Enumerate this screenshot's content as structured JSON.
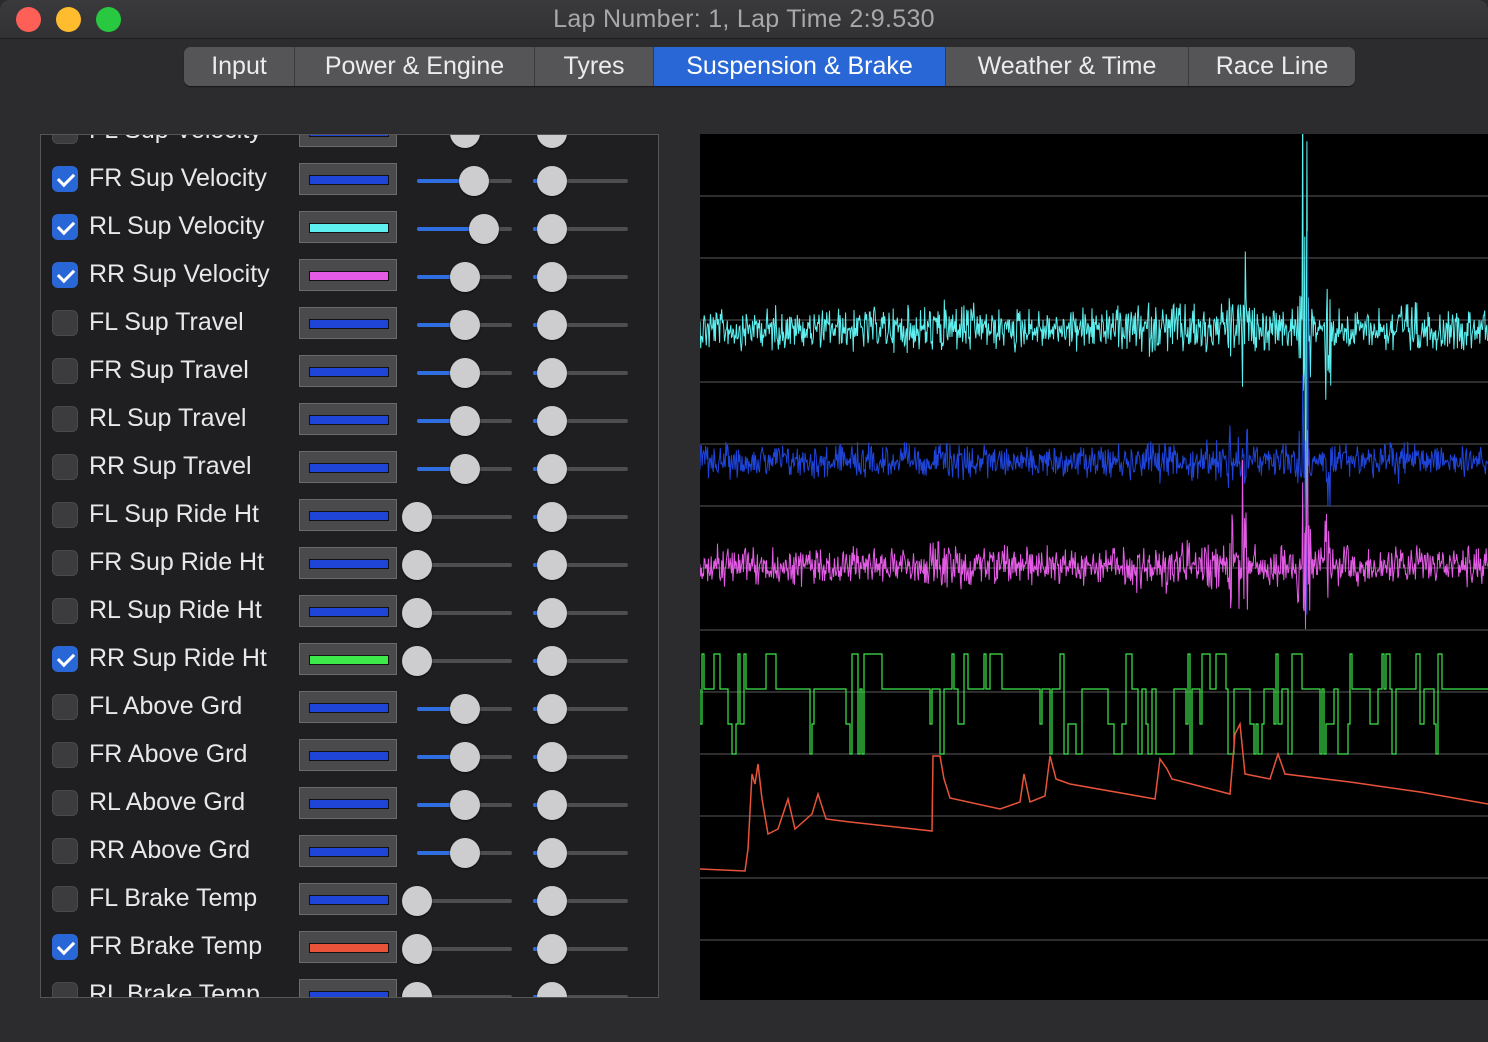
{
  "window": {
    "title": "Lap Number: 1, Lap Time 2:9.530"
  },
  "tabs": [
    {
      "label": "Input",
      "active": false
    },
    {
      "label": "Power & Engine",
      "active": false
    },
    {
      "label": "Tyres",
      "active": false
    },
    {
      "label": "Suspension & Brake",
      "active": true
    },
    {
      "label": "Weather & Time",
      "active": false
    },
    {
      "label": "Race Line",
      "active": false
    }
  ],
  "channels": [
    {
      "label": "FL Sup Velocity",
      "checked": false,
      "color": "#1f44d8",
      "scale": 0.5,
      "offset": 0.2
    },
    {
      "label": "FR Sup Velocity",
      "checked": true,
      "color": "#1f44d8",
      "scale": 0.6,
      "offset": 0.2
    },
    {
      "label": "RL Sup Velocity",
      "checked": true,
      "color": "#5ef0f0",
      "scale": 0.7,
      "offset": 0.2
    },
    {
      "label": "RR Sup Velocity",
      "checked": true,
      "color": "#e45ce6",
      "scale": 0.5,
      "offset": 0.2
    },
    {
      "label": "FL Sup Travel",
      "checked": false,
      "color": "#1f44d8",
      "scale": 0.5,
      "offset": 0.2
    },
    {
      "label": "FR Sup Travel",
      "checked": false,
      "color": "#1f44d8",
      "scale": 0.5,
      "offset": 0.2
    },
    {
      "label": "RL Sup Travel",
      "checked": false,
      "color": "#1f44d8",
      "scale": 0.5,
      "offset": 0.2
    },
    {
      "label": "RR Sup Travel",
      "checked": false,
      "color": "#1f44d8",
      "scale": 0.5,
      "offset": 0.2
    },
    {
      "label": "FL Sup Ride Ht",
      "checked": false,
      "color": "#1f44d8",
      "scale": 0.0,
      "offset": 0.2
    },
    {
      "label": "FR Sup Ride Ht",
      "checked": false,
      "color": "#1f44d8",
      "scale": 0.0,
      "offset": 0.2
    },
    {
      "label": "RL Sup Ride Ht",
      "checked": false,
      "color": "#1f44d8",
      "scale": 0.0,
      "offset": 0.2
    },
    {
      "label": "RR Sup Ride Ht",
      "checked": true,
      "color": "#3ce84a",
      "scale": 0.0,
      "offset": 0.2
    },
    {
      "label": "FL Above Grd",
      "checked": false,
      "color": "#1f44d8",
      "scale": 0.5,
      "offset": 0.2
    },
    {
      "label": "FR Above Grd",
      "checked": false,
      "color": "#1f44d8",
      "scale": 0.5,
      "offset": 0.2
    },
    {
      "label": "RL Above Grd",
      "checked": false,
      "color": "#1f44d8",
      "scale": 0.5,
      "offset": 0.2
    },
    {
      "label": "RR Above Grd",
      "checked": false,
      "color": "#1f44d8",
      "scale": 0.5,
      "offset": 0.2
    },
    {
      "label": "FL Brake Temp",
      "checked": false,
      "color": "#1f44d8",
      "scale": 0.0,
      "offset": 0.2
    },
    {
      "label": "FR Brake Temp",
      "checked": true,
      "color": "#e8533a",
      "scale": 0.0,
      "offset": 0.2
    },
    {
      "label": "RL Brake Temp",
      "checked": false,
      "color": "#1f44d8",
      "scale": 0.0,
      "offset": 0.2
    }
  ],
  "graph": {
    "background": "#000000",
    "traces": [
      {
        "name": "RL Sup Velocity",
        "color": "#5ef0f0"
      },
      {
        "name": "FR Sup Velocity",
        "color": "#1f44d8"
      },
      {
        "name": "RR Sup Velocity",
        "color": "#e45ce6"
      },
      {
        "name": "RR Sup Ride Ht",
        "color": "#3ce84a"
      },
      {
        "name": "FR Brake Temp",
        "color": "#e8533a"
      }
    ]
  }
}
